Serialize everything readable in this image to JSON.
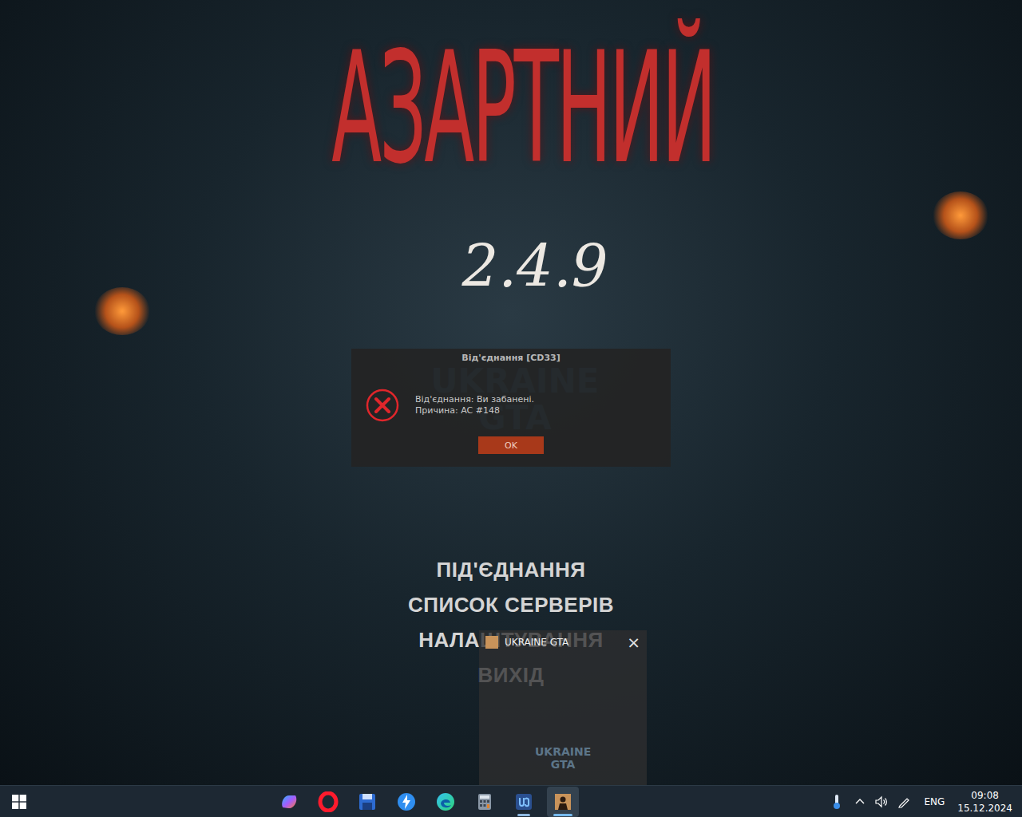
{
  "background": {
    "title": "АЗАРТНИЙ",
    "version": "2.4.9",
    "watermark": "UKRAINE GTA"
  },
  "dialog": {
    "title": "Від'єднання [CD33]",
    "lines": [
      "Від'єднання: Ви забанені.",
      "Причина: AC #148"
    ],
    "button": "OK"
  },
  "menu": [
    {
      "label": "ПІД'ЄДНАННЯ"
    },
    {
      "label": "СПИСОК СЕРВЕРІВ"
    },
    {
      "label": "НАЛАШТУВАННЯ"
    },
    {
      "label": "ВИХІД"
    }
  ],
  "mini_window": {
    "title": "UKRAINE GTA",
    "close": "×",
    "logo": "UKRAINE GTA"
  },
  "taskbar": {
    "apps": [
      {
        "kind": "copilot",
        "active": false
      },
      {
        "kind": "opera",
        "active": false
      },
      {
        "kind": "save",
        "active": false
      },
      {
        "kind": "bolt",
        "active": false
      },
      {
        "kind": "edge",
        "active": false
      },
      {
        "kind": "calculator",
        "active": false
      },
      {
        "kind": "launcher",
        "active": true
      },
      {
        "kind": "gta",
        "active": true
      }
    ],
    "language": "ENG",
    "time": "09:08",
    "date": "15.12.2024"
  }
}
